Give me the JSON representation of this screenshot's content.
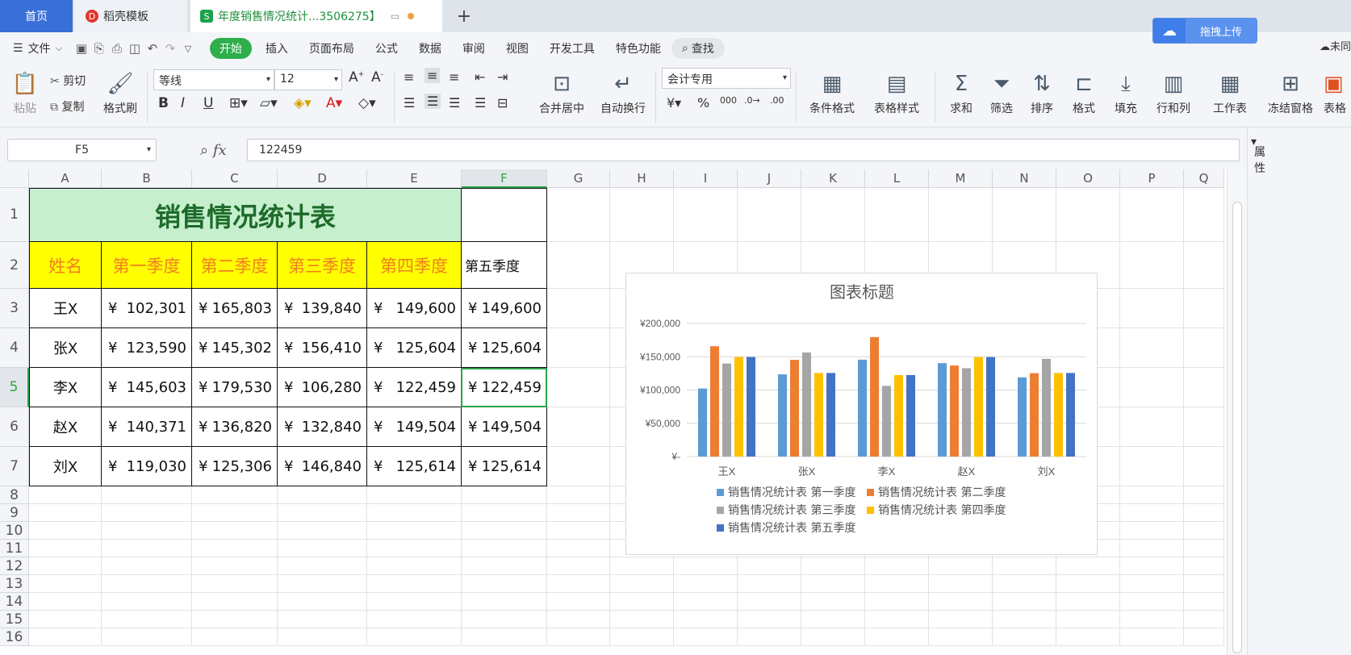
{
  "tabs": {
    "home": "首页",
    "templates": "稻壳模板",
    "document": "年度销售情况统计...3506275】"
  },
  "upload_label": "拖拽上传",
  "cloud_right": "未同",
  "menu": {
    "file": "文件",
    "items": [
      "开始",
      "插入",
      "页面布局",
      "公式",
      "数据",
      "审阅",
      "视图",
      "开发工具",
      "特色功能"
    ],
    "search": "查找"
  },
  "ribbon": {
    "paste": "粘贴",
    "cut": "剪切",
    "copy": "复制",
    "format_painter": "格式刷",
    "font_name": "等线",
    "font_size": "12",
    "number_format": "会计专用",
    "merge_center": "合并居中",
    "wrap_text": "自动换行",
    "cond_format": "条件格式",
    "table_style": "表格样式",
    "sum": "求和",
    "filter": "筛选",
    "sort": "排序",
    "format": "格式",
    "fill": "填充",
    "row_col": "行和列",
    "worksheet": "工作表",
    "freeze": "冻结窗格",
    "table_tools": "表格"
  },
  "namebox": "F5",
  "formula_value": "122459",
  "props_label": "属性",
  "columns": [
    "A",
    "B",
    "C",
    "D",
    "E",
    "F",
    "G",
    "H",
    "I",
    "J",
    "K",
    "L",
    "M",
    "N",
    "O",
    "P",
    "Q"
  ],
  "rows": [
    "1",
    "2",
    "3",
    "4",
    "5",
    "6",
    "7",
    "8",
    "9",
    "10",
    "11",
    "12",
    "13",
    "14",
    "15",
    "16"
  ],
  "sheet": {
    "title": "销售情况统计表",
    "headers": [
      "姓名",
      "第一季度",
      "第二季度",
      "第三季度",
      "第四季度",
      "第五季度"
    ],
    "currency": "¥",
    "data": [
      {
        "name": "王X",
        "v": [
          "102,301",
          "165,803",
          "139,840",
          "149,600",
          "149,600"
        ]
      },
      {
        "name": "张X",
        "v": [
          "123,590",
          "145,302",
          "156,410",
          "125,604",
          "125,604"
        ]
      },
      {
        "name": "李X",
        "v": [
          "145,603",
          "179,530",
          "106,280",
          "122,459",
          "122,459"
        ]
      },
      {
        "name": "赵X",
        "v": [
          "140,371",
          "136,820",
          "132,840",
          "149,504",
          "149,504"
        ]
      },
      {
        "name": "刘X",
        "v": [
          "119,030",
          "125,306",
          "146,840",
          "125,614",
          "125,614"
        ]
      }
    ]
  },
  "chart_data": {
    "type": "bar",
    "title": "图表标题",
    "categories": [
      "王X",
      "张X",
      "李X",
      "赵X",
      "刘X"
    ],
    "ylim": [
      0,
      200000
    ],
    "yticks": [
      "¥-",
      "¥50,000",
      "¥100,000",
      "¥150,000",
      "¥200,000"
    ],
    "grid": true,
    "legend": "bottom",
    "series": [
      {
        "name": "销售情况统计表 第一季度",
        "color": "#5b9bd5",
        "values": [
          102301,
          123590,
          145603,
          140371,
          119030
        ]
      },
      {
        "name": "销售情况统计表 第二季度",
        "color": "#ed7d31",
        "values": [
          165803,
          145302,
          179530,
          136820,
          125306
        ]
      },
      {
        "name": "销售情况统计表 第三季度",
        "color": "#a5a5a5",
        "values": [
          139840,
          156410,
          106280,
          132840,
          146840
        ]
      },
      {
        "name": "销售情况统计表 第四季度",
        "color": "#ffc000",
        "values": [
          149600,
          125604,
          122459,
          149504,
          125614
        ]
      },
      {
        "name": "销售情况统计表 第五季度",
        "color": "#4472c4",
        "values": [
          149600,
          125604,
          122459,
          149504,
          125614
        ]
      }
    ]
  }
}
